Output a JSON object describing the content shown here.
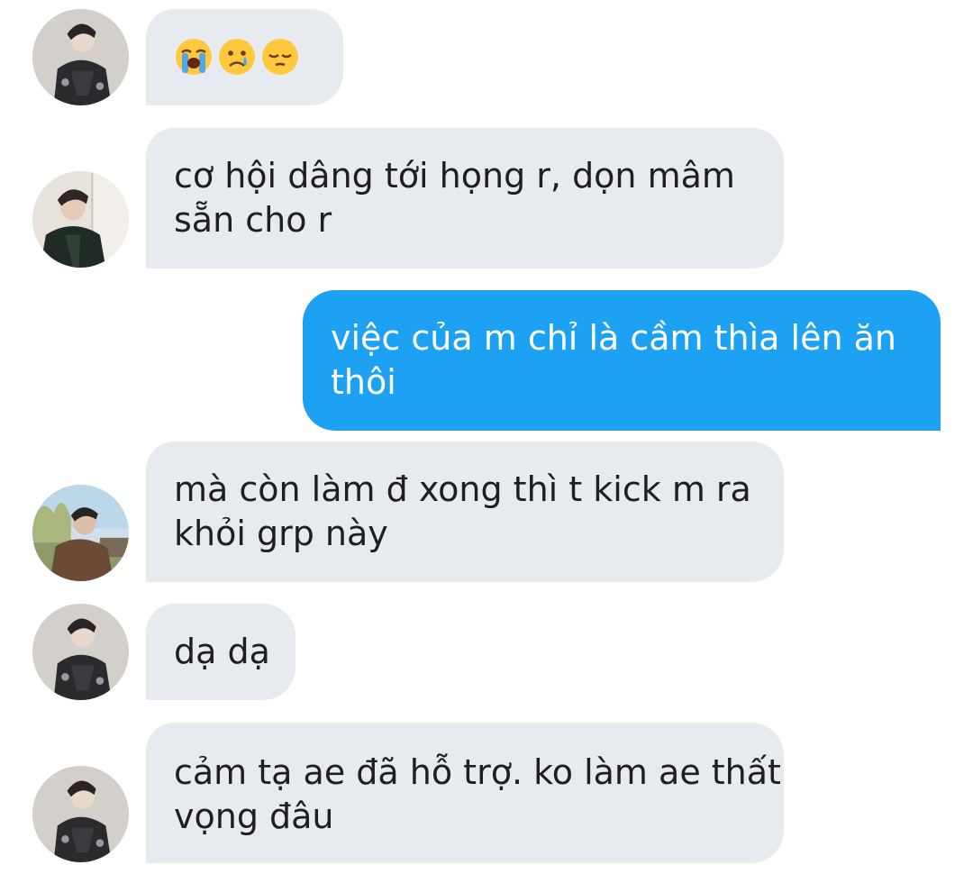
{
  "messages": [
    {
      "direction": "incoming",
      "sender_avatar": "avatar-jacket",
      "type": "emoji",
      "emojis": [
        "loudly-crying-face-emoji",
        "crying-face-emoji",
        "pensive-face-emoji"
      ]
    },
    {
      "direction": "incoming",
      "sender_avatar": "avatar-window",
      "type": "text",
      "text": "cơ hội dâng tới họng r, dọn mâm sẵn cho r"
    },
    {
      "direction": "outgoing",
      "type": "text",
      "text": "việc của m chỉ là cầm thìa lên ăn thôi"
    },
    {
      "direction": "incoming",
      "sender_avatar": "avatar-outdoor",
      "type": "text",
      "text": "mà còn làm đ xong thì t kick m ra khỏi grp này"
    },
    {
      "direction": "incoming",
      "sender_avatar": "avatar-jacket",
      "type": "text",
      "text": "dạ dạ"
    },
    {
      "direction": "incoming",
      "sender_avatar": "avatar-jacket",
      "type": "text",
      "text": "cảm tạ ae đã hỗ trợ. ko làm ae thất vọng đâu"
    }
  ],
  "colors": {
    "incoming_bubble": "#e7eaee",
    "outgoing_bubble": "#1da1f2",
    "incoming_text": "#1f1f1f",
    "outgoing_text": "#ffffff"
  }
}
